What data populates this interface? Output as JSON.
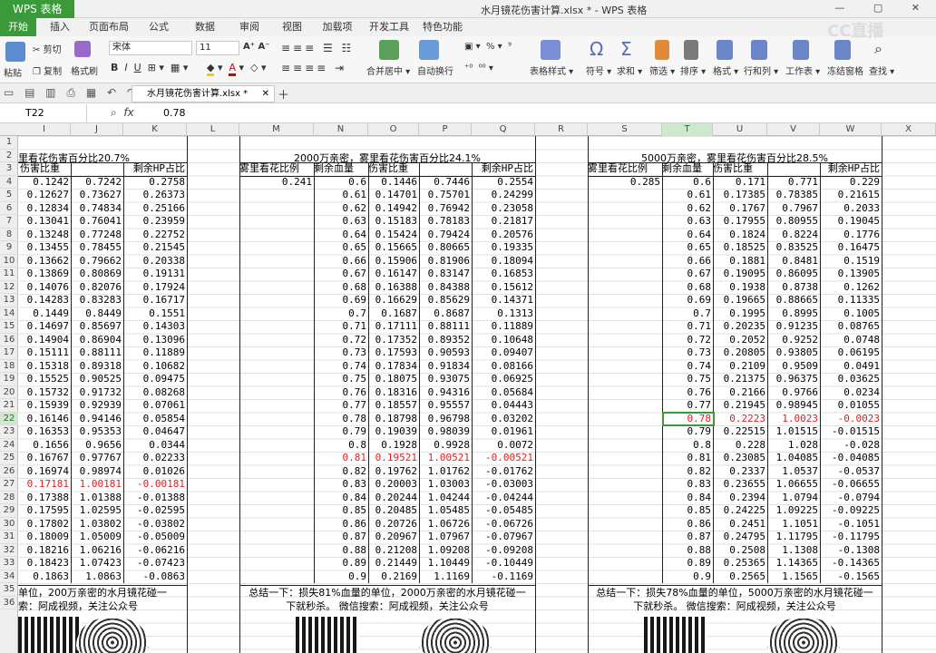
{
  "titlebar": {
    "app": "WPS 表格",
    "document": "水月镜花伤害计算.xlsx * - WPS 表格",
    "watermark": "CC直播"
  },
  "tabs": [
    "开始",
    "插入",
    "页面布局",
    "公式",
    "数据",
    "审阅",
    "视图",
    "加载项",
    "开发工具",
    "特色功能"
  ],
  "ribbon": {
    "paste": "粘贴",
    "cut": "剪切",
    "copy": "复制",
    "format_painter": "格式刷",
    "font": "宋体",
    "size": "11",
    "merge": "合并居中",
    "wrap": "自动换行",
    "table_style": "表格样式",
    "symbol": "符号",
    "sum": "求和",
    "filter": "筛选",
    "sort": "排序",
    "format": "格式",
    "rowcol": "行和列",
    "sheet": "工作表",
    "freeze": "冻结窗格",
    "find": "查找"
  },
  "file_tab": "水月镜花伤害计算.xlsx *",
  "formula": {
    "name_box": "T22",
    "value": "0.78"
  },
  "columns": [
    "I",
    "J",
    "K",
    "L",
    "M",
    "N",
    "O",
    "P",
    "Q",
    "R",
    "S",
    "T",
    "U",
    "V",
    "W",
    "X"
  ],
  "rows": [
    "1",
    "2",
    "3",
    "4",
    "5",
    "6",
    "7",
    "8",
    "9",
    "10",
    "11",
    "12",
    "13",
    "14",
    "15",
    "16",
    "17",
    "18",
    "19",
    "20",
    "21",
    "22",
    "23",
    "24",
    "25",
    "26",
    "27",
    "28",
    "29",
    "30",
    "31",
    "32",
    "33",
    "34",
    "35",
    "36"
  ],
  "block1": {
    "title": "里看花伤害百分比20.7%",
    "h1": "伤害比重",
    "h3": "剩余HP占比",
    "rows": [
      [
        "0.1242",
        "0.7242",
        "0.2758"
      ],
      [
        "0.12627",
        "0.73627",
        "0.26373"
      ],
      [
        "0.12834",
        "0.74834",
        "0.25166"
      ],
      [
        "0.13041",
        "0.76041",
        "0.23959"
      ],
      [
        "0.13248",
        "0.77248",
        "0.22752"
      ],
      [
        "0.13455",
        "0.78455",
        "0.21545"
      ],
      [
        "0.13662",
        "0.79662",
        "0.20338"
      ],
      [
        "0.13869",
        "0.80869",
        "0.19131"
      ],
      [
        "0.14076",
        "0.82076",
        "0.17924"
      ],
      [
        "0.14283",
        "0.83283",
        "0.16717"
      ],
      [
        "0.1449",
        "0.8449",
        "0.1551"
      ],
      [
        "0.14697",
        "0.85697",
        "0.14303"
      ],
      [
        "0.14904",
        "0.86904",
        "0.13096"
      ],
      [
        "0.15111",
        "0.88111",
        "0.11889"
      ],
      [
        "0.15318",
        "0.89318",
        "0.10682"
      ],
      [
        "0.15525",
        "0.90525",
        "0.09475"
      ],
      [
        "0.15732",
        "0.91732",
        "0.08268"
      ],
      [
        "0.15939",
        "0.92939",
        "0.07061"
      ],
      [
        "0.16146",
        "0.94146",
        "0.05854"
      ],
      [
        "0.16353",
        "0.95353",
        "0.04647"
      ],
      [
        "0.1656",
        "0.9656",
        "0.0344"
      ],
      [
        "0.16767",
        "0.97767",
        "0.02233"
      ],
      [
        "0.16974",
        "0.98974",
        "0.01026"
      ],
      [
        "0.17181",
        "1.00181",
        "-0.00181"
      ],
      [
        "0.17388",
        "1.01388",
        "-0.01388"
      ],
      [
        "0.17595",
        "1.02595",
        "-0.02595"
      ],
      [
        "0.17802",
        "1.03802",
        "-0.03802"
      ],
      [
        "0.18009",
        "1.05009",
        "-0.05009"
      ],
      [
        "0.18216",
        "1.06216",
        "-0.06216"
      ],
      [
        "0.18423",
        "1.07423",
        "-0.07423"
      ],
      [
        "0.1863",
        "1.0863",
        "-0.0863"
      ]
    ],
    "red_row": 23,
    "footer1": "单位，200万亲密的水月镜花碰一",
    "footer2": "索：阿成视频，关注公众号"
  },
  "block2": {
    "title": "2000万亲密，雾里看花伤害百分比24.1%",
    "h1": "雾里看花比例",
    "h2": "剩余血量",
    "h3": "伤害比重",
    "h5": "剩余HP占比",
    "ratio": "0.241",
    "rows": [
      [
        "0.6",
        "0.1446",
        "0.7446",
        "0.2554"
      ],
      [
        "0.61",
        "0.14701",
        "0.75701",
        "0.24299"
      ],
      [
        "0.62",
        "0.14942",
        "0.76942",
        "0.23058"
      ],
      [
        "0.63",
        "0.15183",
        "0.78183",
        "0.21817"
      ],
      [
        "0.64",
        "0.15424",
        "0.79424",
        "0.20576"
      ],
      [
        "0.65",
        "0.15665",
        "0.80665",
        "0.19335"
      ],
      [
        "0.66",
        "0.15906",
        "0.81906",
        "0.18094"
      ],
      [
        "0.67",
        "0.16147",
        "0.83147",
        "0.16853"
      ],
      [
        "0.68",
        "0.16388",
        "0.84388",
        "0.15612"
      ],
      [
        "0.69",
        "0.16629",
        "0.85629",
        "0.14371"
      ],
      [
        "0.7",
        "0.1687",
        "0.8687",
        "0.1313"
      ],
      [
        "0.71",
        "0.17111",
        "0.88111",
        "0.11889"
      ],
      [
        "0.72",
        "0.17352",
        "0.89352",
        "0.10648"
      ],
      [
        "0.73",
        "0.17593",
        "0.90593",
        "0.09407"
      ],
      [
        "0.74",
        "0.17834",
        "0.91834",
        "0.08166"
      ],
      [
        "0.75",
        "0.18075",
        "0.93075",
        "0.06925"
      ],
      [
        "0.76",
        "0.18316",
        "0.94316",
        "0.05684"
      ],
      [
        "0.77",
        "0.18557",
        "0.95557",
        "0.04443"
      ],
      [
        "0.78",
        "0.18798",
        "0.96798",
        "0.03202"
      ],
      [
        "0.79",
        "0.19039",
        "0.98039",
        "0.01961"
      ],
      [
        "0.8",
        "0.1928",
        "0.9928",
        "0.0072"
      ],
      [
        "0.81",
        "0.19521",
        "1.00521",
        "-0.00521"
      ],
      [
        "0.82",
        "0.19762",
        "1.01762",
        "-0.01762"
      ],
      [
        "0.83",
        "0.20003",
        "1.03003",
        "-0.03003"
      ],
      [
        "0.84",
        "0.20244",
        "1.04244",
        "-0.04244"
      ],
      [
        "0.85",
        "0.20485",
        "1.05485",
        "-0.05485"
      ],
      [
        "0.86",
        "0.20726",
        "1.06726",
        "-0.06726"
      ],
      [
        "0.87",
        "0.20967",
        "1.07967",
        "-0.07967"
      ],
      [
        "0.88",
        "0.21208",
        "1.09208",
        "-0.09208"
      ],
      [
        "0.89",
        "0.21449",
        "1.10449",
        "-0.10449"
      ],
      [
        "0.9",
        "0.2169",
        "1.1169",
        "-0.1169"
      ]
    ],
    "red_row": 21,
    "footer1": "总结一下：损失81%血量的单位，2000万亲密的水月镜花碰一",
    "footer2": "下就秒杀。 微信搜索：阿成视频，关注公众号"
  },
  "block3": {
    "title": "5000万亲密，雾里看花伤害百分比28.5%",
    "h1": "雾里看花比例",
    "h2": "剩余血量",
    "h3": "伤害比重",
    "h5": "剩余HP占比",
    "ratio": "0.285",
    "rows": [
      [
        "0.6",
        "0.171",
        "0.771",
        "0.229"
      ],
      [
        "0.61",
        "0.17385",
        "0.78385",
        "0.21615"
      ],
      [
        "0.62",
        "0.1767",
        "0.7967",
        "0.2033"
      ],
      [
        "0.63",
        "0.17955",
        "0.80955",
        "0.19045"
      ],
      [
        "0.64",
        "0.1824",
        "0.8224",
        "0.1776"
      ],
      [
        "0.65",
        "0.18525",
        "0.83525",
        "0.16475"
      ],
      [
        "0.66",
        "0.1881",
        "0.8481",
        "0.1519"
      ],
      [
        "0.67",
        "0.19095",
        "0.86095",
        "0.13905"
      ],
      [
        "0.68",
        "0.1938",
        "0.8738",
        "0.1262"
      ],
      [
        "0.69",
        "0.19665",
        "0.88665",
        "0.11335"
      ],
      [
        "0.7",
        "0.1995",
        "0.8995",
        "0.1005"
      ],
      [
        "0.71",
        "0.20235",
        "0.91235",
        "0.08765"
      ],
      [
        "0.72",
        "0.2052",
        "0.9252",
        "0.0748"
      ],
      [
        "0.73",
        "0.20805",
        "0.93805",
        "0.06195"
      ],
      [
        "0.74",
        "0.2109",
        "0.9509",
        "0.0491"
      ],
      [
        "0.75",
        "0.21375",
        "0.96375",
        "0.03625"
      ],
      [
        "0.76",
        "0.2166",
        "0.9766",
        "0.0234"
      ],
      [
        "0.77",
        "0.21945",
        "0.98945",
        "0.01055"
      ],
      [
        "0.78",
        "0.2223",
        "1.0023",
        "-0.0023"
      ],
      [
        "0.79",
        "0.22515",
        "1.01515",
        "-0.01515"
      ],
      [
        "0.8",
        "0.228",
        "1.028",
        "-0.028"
      ],
      [
        "0.81",
        "0.23085",
        "1.04085",
        "-0.04085"
      ],
      [
        "0.82",
        "0.2337",
        "1.0537",
        "-0.0537"
      ],
      [
        "0.83",
        "0.23655",
        "1.06655",
        "-0.06655"
      ],
      [
        "0.84",
        "0.2394",
        "1.0794",
        "-0.0794"
      ],
      [
        "0.85",
        "0.24225",
        "1.09225",
        "-0.09225"
      ],
      [
        "0.86",
        "0.2451",
        "1.1051",
        "-0.1051"
      ],
      [
        "0.87",
        "0.24795",
        "1.11795",
        "-0.11795"
      ],
      [
        "0.88",
        "0.2508",
        "1.1308",
        "-0.1308"
      ],
      [
        "0.89",
        "0.25365",
        "1.14365",
        "-0.14365"
      ],
      [
        "0.9",
        "0.2565",
        "1.1565",
        "-0.1565"
      ]
    ],
    "red_row": 18,
    "footer1": "总结一下：损失78%血量的单位，5000万亲密的水月镜花碰一",
    "footer2": "下就秒杀。 微信搜索：阿成视频，关注公众号"
  }
}
